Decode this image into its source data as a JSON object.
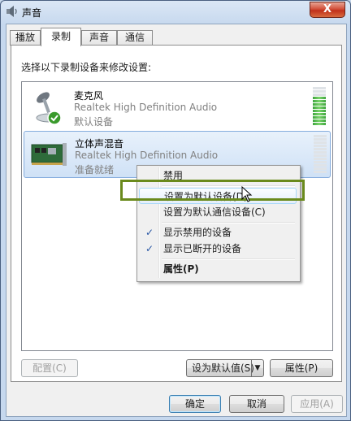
{
  "window": {
    "title": "声音",
    "close_label": "X"
  },
  "tabs": [
    {
      "label": "播放",
      "active": false
    },
    {
      "label": "录制",
      "active": true
    },
    {
      "label": "声音",
      "active": false
    },
    {
      "label": "通信",
      "active": false
    }
  ],
  "instruction": "选择以下录制设备来修改设置:",
  "devices": [
    {
      "name": "麦克风",
      "driver": "Realtek High Definition Audio",
      "status": "默认设备",
      "icon": "microphone-icon",
      "default": true,
      "level": 0.75
    },
    {
      "name": "立体声混音",
      "driver": "Realtek High Definition Audio",
      "status": "准备就绪",
      "icon": "sound-card-icon",
      "selected": true,
      "level": 0
    }
  ],
  "context_menu": {
    "items": [
      {
        "label": "禁用"
      },
      {
        "label": "设置为默认设备(D)",
        "hovered": true
      },
      {
        "label": "设置为默认通信设备(C)"
      },
      {
        "label": "显示禁用的设备",
        "checked": true
      },
      {
        "label": "显示已断开的设备",
        "checked": true
      },
      {
        "label": "属性(P)",
        "bold": true
      }
    ]
  },
  "buttons": {
    "configure": "配置(C)",
    "set_default": "设为默认值(S)",
    "properties": "属性(P)",
    "ok": "确定",
    "cancel": "取消",
    "apply": "应用(A)"
  },
  "colors": {
    "highlight_box": "#6a8a1c",
    "selection": "#cfe1f6",
    "accent": "#3c7fb1"
  }
}
